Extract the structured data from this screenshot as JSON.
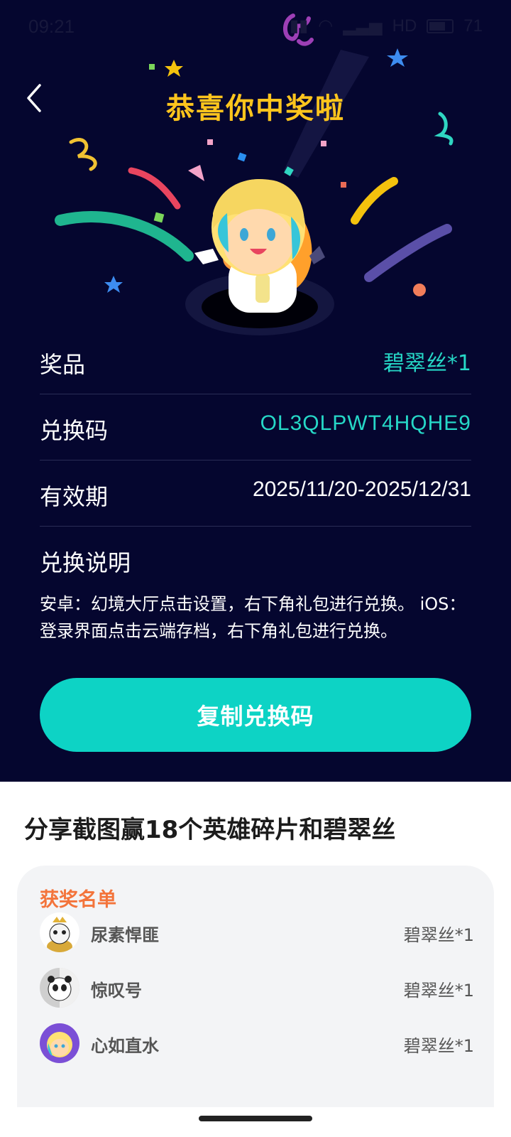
{
  "status_bar": {
    "time": "09:21",
    "network": "HD",
    "battery": "71"
  },
  "header": {
    "title": "恭喜你中奖啦"
  },
  "prize": {
    "label": "奖品",
    "value": "碧翠丝*1"
  },
  "code": {
    "label": "兑换码",
    "value": "OL3QLPWT4HQHE9"
  },
  "validity": {
    "label": "有效期",
    "value": "2025/11/20-2025/12/31"
  },
  "instructions": {
    "title": "兑换说明",
    "text": "安卓：幻境大厅点击设置，右下角礼包进行兑换。 iOS：登录界面点击云端存档，右下角礼包进行兑换。"
  },
  "copy_button": {
    "label": "复制兑换码"
  },
  "share": {
    "title": "分享截图赢18个英雄碎片和碧翠丝"
  },
  "winners": {
    "title": "获奖名单",
    "items": [
      {
        "name": "尿素悍匪",
        "prize": "碧翠丝*1"
      },
      {
        "name": "惊叹号",
        "prize": "碧翠丝*1"
      },
      {
        "name": "心如直水",
        "prize": "碧翠丝*1"
      }
    ]
  },
  "colors": {
    "background": "#05062f",
    "title": "#ffc51d",
    "accent": "#0dd3c5",
    "list_title": "#f3743b"
  }
}
